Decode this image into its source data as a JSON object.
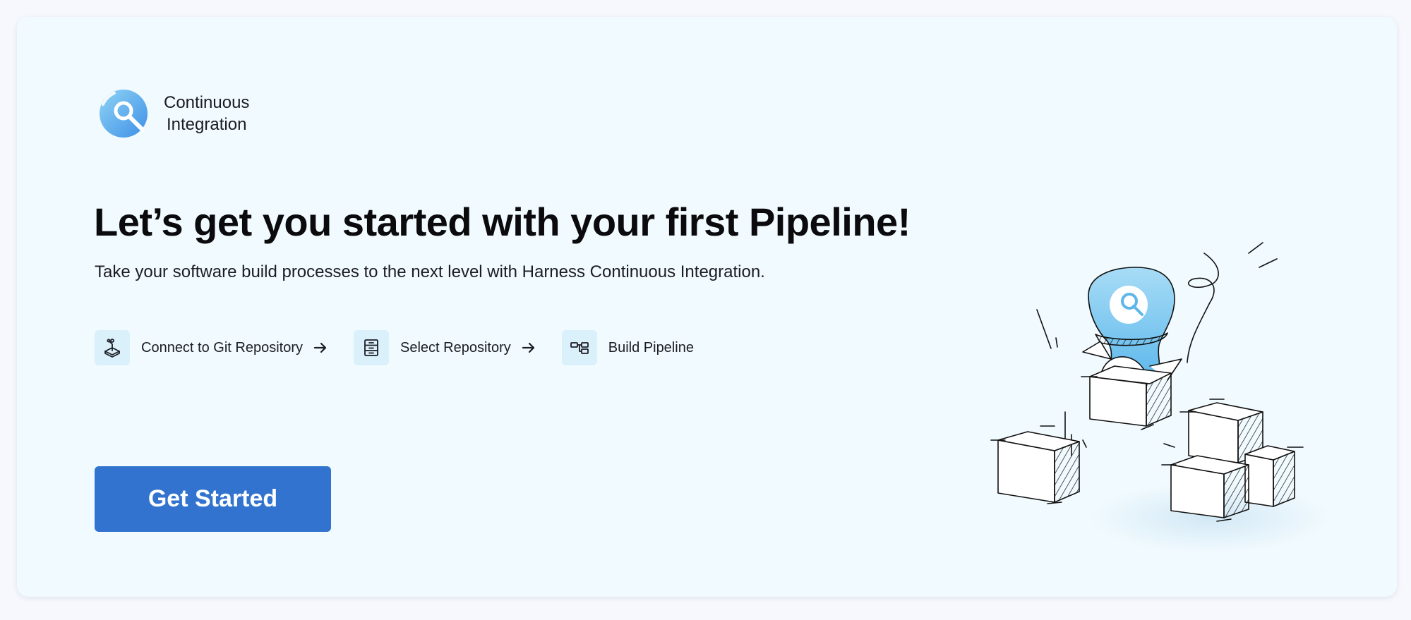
{
  "module": {
    "name_line1": "Continuous",
    "name_line2": "Integration",
    "icon": "ci-module-logo-icon"
  },
  "hero": {
    "headline": "Let’s get you started with your first Pipeline!",
    "subtitle": "Take your software build processes to the next level with Harness Continuous Integration."
  },
  "steps": [
    {
      "label": "Connect to Git Repository",
      "icon": "git-repo-connector-icon"
    },
    {
      "label": "Select Repository",
      "icon": "repository-cabinet-icon"
    },
    {
      "label": "Build Pipeline",
      "icon": "pipeline-flow-icon"
    }
  ],
  "cta": {
    "label": "Get Started"
  },
  "colors": {
    "accent": "#3273cf",
    "card_background": "#f1fafe",
    "step_icon_background": "#daf1fb",
    "logo_gradient_start": "#8fd4f4",
    "logo_gradient_end": "#3e8fe8"
  }
}
